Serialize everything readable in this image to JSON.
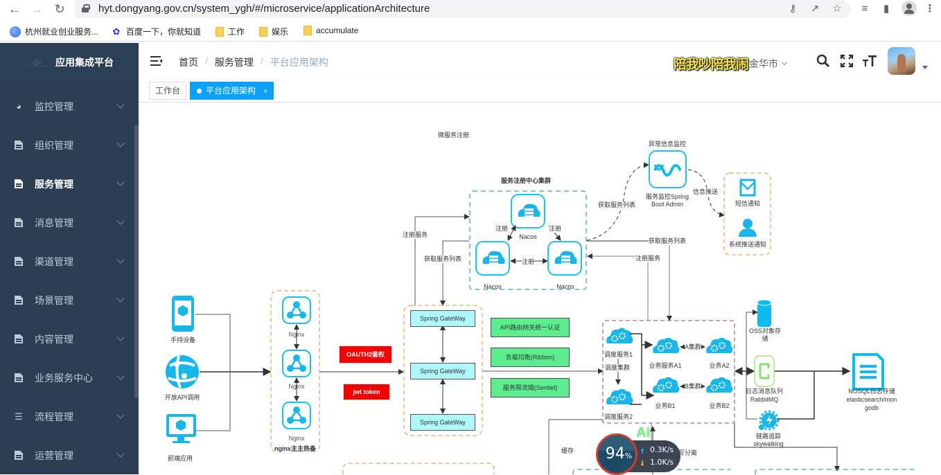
{
  "browser": {
    "url": "hyt.dongyang.gov.cn/system_ygh/#/microservice/applicationArchitecture",
    "bookmarks": [
      {
        "label": "杭州就业创业服务...",
        "icon": "site-favicon"
      },
      {
        "label": "百度一下，你就知道",
        "icon": "baidu-paw-icon"
      },
      {
        "label": "工作",
        "icon": "folder-icon"
      },
      {
        "label": "娱乐",
        "icon": "folder-icon"
      },
      {
        "label": "accumulate",
        "icon": "folder-icon"
      }
    ]
  },
  "sidebar": {
    "title": "应用集成平台",
    "items": [
      {
        "label": "监控管理",
        "icon": "dashboard-icon",
        "active": false
      },
      {
        "label": "组织管理",
        "icon": "document-icon",
        "active": false
      },
      {
        "label": "服务管理",
        "icon": "document-icon",
        "active": true
      },
      {
        "label": "消息管理",
        "icon": "document-icon",
        "active": false
      },
      {
        "label": "渠道管理",
        "icon": "document-icon",
        "active": false
      },
      {
        "label": "场景管理",
        "icon": "document-icon",
        "active": false
      },
      {
        "label": "内容管理",
        "icon": "document-edit-icon",
        "active": false
      },
      {
        "label": "业务服务中心",
        "icon": "document-icon",
        "active": false
      },
      {
        "label": "流程管理",
        "icon": "sliders-icon",
        "active": false
      },
      {
        "label": "运营管理",
        "icon": "document-icon",
        "active": false
      }
    ]
  },
  "header": {
    "breadcrumb": [
      "首页",
      "服务管理",
      "平台应用架构"
    ],
    "watermark": "陪我吵陪我闹",
    "city": "金华市",
    "icons": [
      "search-icon",
      "fullscreen-icon",
      "font-size-icon"
    ]
  },
  "tags": [
    {
      "label": "工作台",
      "active": false
    },
    {
      "label": "平台应用架构",
      "active": true,
      "close": "×"
    }
  ],
  "diagram": {
    "labels": {
      "micro_register": "微服务注册",
      "registry_cluster": "服务注册中心集群",
      "nacos": "Nacos",
      "register": "注册",
      "register_service": "注册服务",
      "get_service_list": "获取服务列表",
      "exception_monitor": "异常信息监控",
      "spring_boot_admin_1": "服务监控Spring",
      "spring_boot_admin_2": "Boot Admin",
      "info_push": "信息推送",
      "sms_notify": "短信通知",
      "system_push": "系统推送通知",
      "handheld": "手持设备",
      "open_api": "开放API调用",
      "frontend_app": "前端应用",
      "nginx": "Nginx",
      "nginx_ha": "nginx主主热备",
      "oauth2": "OAUTH2鉴权",
      "jwt": "jwt token",
      "gateway": "Spring GateWay",
      "api_route": "API路由网关统一认证",
      "load_balance": "负载均衡(Ribbon)",
      "rate_limit": "服务限流熔(Sentiel)",
      "cache": "缓存",
      "dispatch1": "调度服务1",
      "dispatch_cluster": "调度集群",
      "dispatch2": "调度服务2",
      "biz_a1": "业务服务A1",
      "biz_a2": "业务A2",
      "cluster_a": "A集群",
      "biz_b1": "业务B1",
      "biz_b2": "业务B2",
      "cluster_b": "B集群",
      "oss_1": "OSS对象存",
      "oss_2": "储",
      "mq_1": "日志消息队列",
      "mq_2": "RabbitMQ",
      "trace_1": "链路追踪",
      "trace_2": "skywalking",
      "nosql_1": "NOSQL日志存储",
      "nosql_2": "elasticsearch/mon",
      "nosql_3": "godb",
      "separation": "写分离"
    }
  },
  "speed_widget": {
    "percent": "94",
    "percent_unit": "%",
    "upload": "0.3",
    "download": "1.0",
    "unit": "K/s",
    "ai_badge": "AI"
  }
}
